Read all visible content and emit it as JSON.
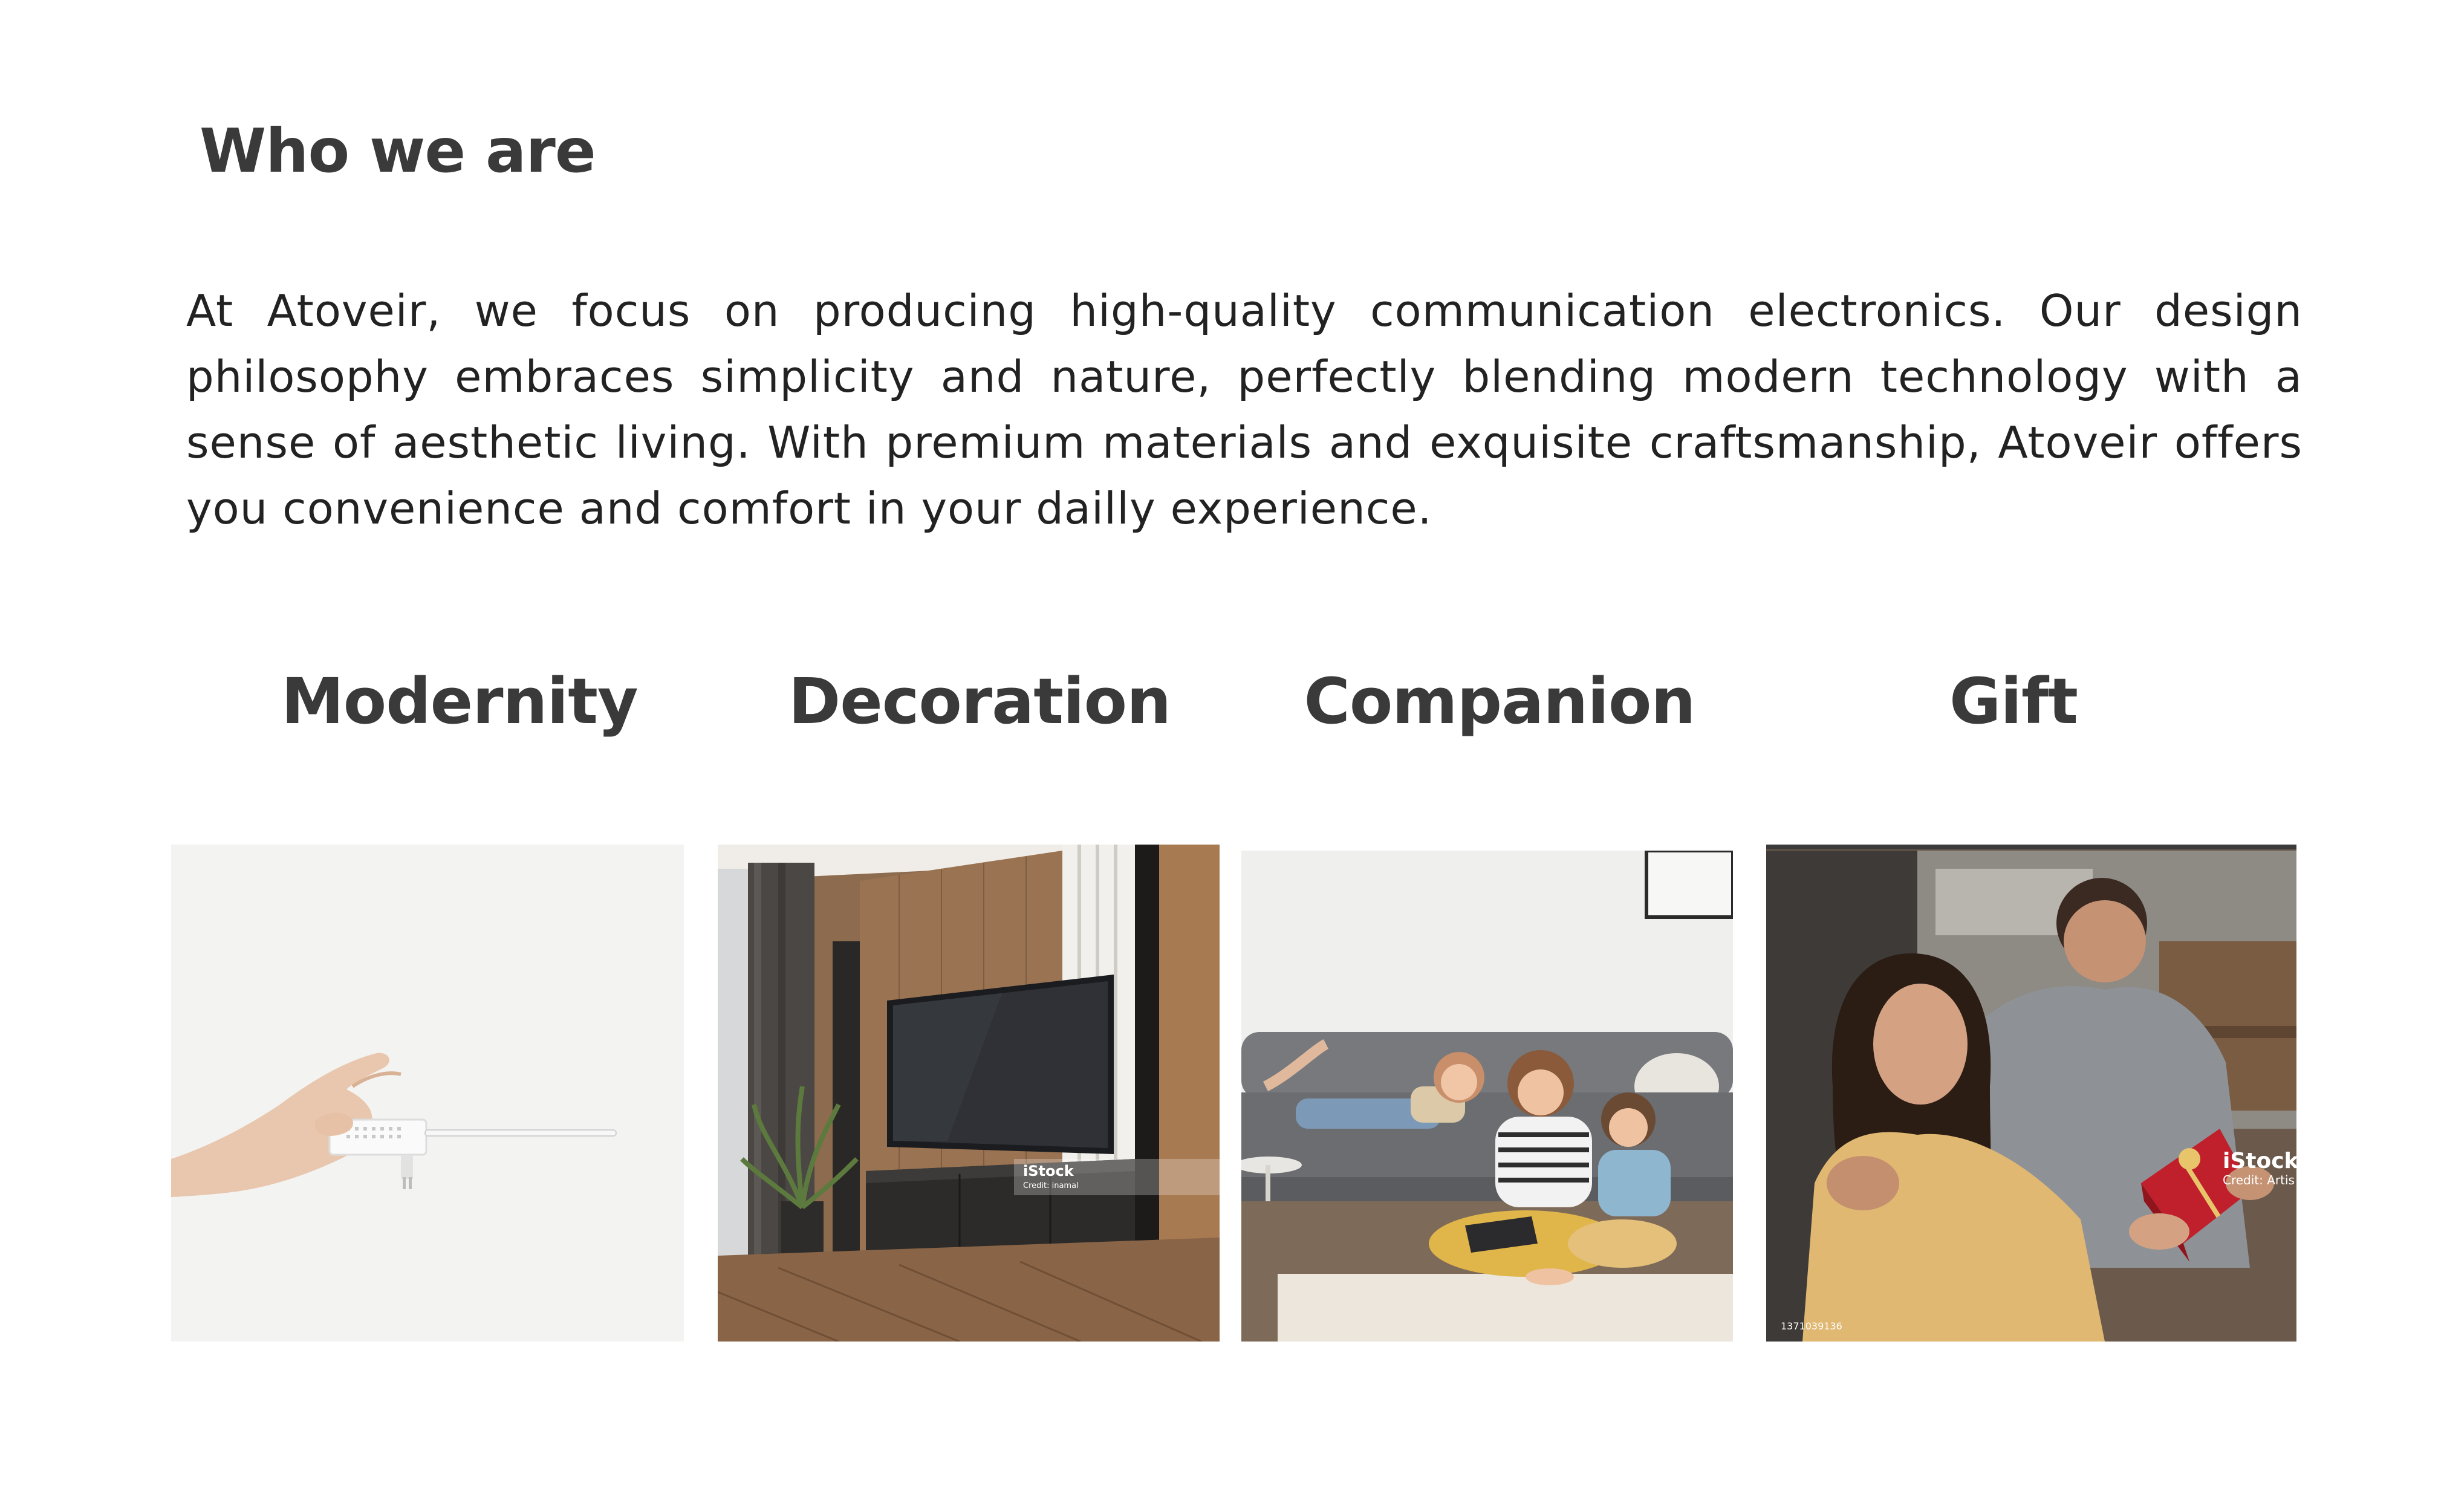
{
  "page": {
    "heading": "Who we are",
    "intro": "At Atoveir, we focus on producing high-quality communication electronics. Our design philosophy embraces simplicity and nature, perfectly blending modern technology with a sense of aesthetic living. With premium materials and exquisite craftsmanship, Atoveir offers you convenience and comfort in your dailly experience."
  },
  "categories": [
    {
      "title": "Modernity",
      "image": "hand-holding-wifi-extender-photo"
    },
    {
      "title": "Decoration",
      "image": "living-room-tv-wall-photo",
      "watermark": "iStock",
      "watermark_sub": "Credit: inamal"
    },
    {
      "title": "Companion",
      "image": "family-on-sofa-photo"
    },
    {
      "title": "Gift",
      "image": "couple-with-gift-box-photo",
      "watermark": "iStock",
      "watermark_sub": "Credit: Artis",
      "stock_id": "1371039136"
    }
  ],
  "colors": {
    "heading": "#3a3a3a",
    "text": "#222222",
    "background": "#ffffff"
  }
}
